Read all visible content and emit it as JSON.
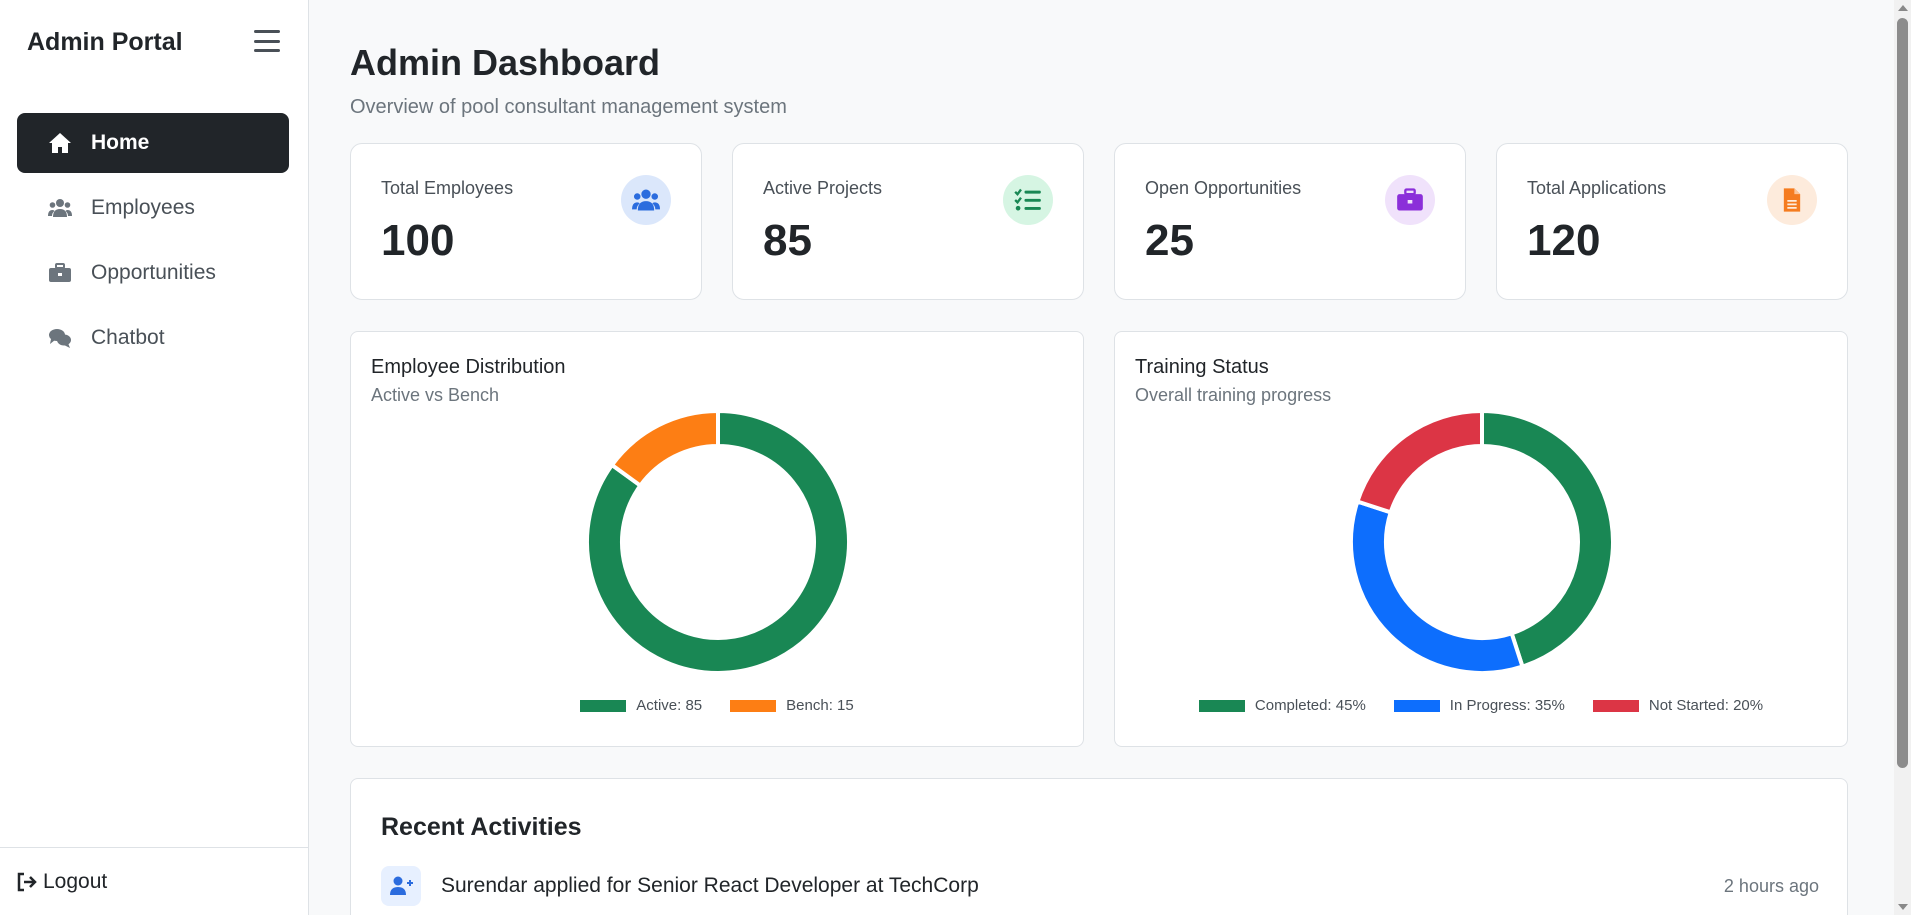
{
  "sidebar": {
    "brand": "Admin Portal",
    "items": [
      {
        "label": "Home",
        "icon": "home-icon",
        "active": true
      },
      {
        "label": "Employees",
        "icon": "users-icon",
        "active": false
      },
      {
        "label": "Opportunities",
        "icon": "briefcase-icon",
        "active": false
      },
      {
        "label": "Chatbot",
        "icon": "comments-icon",
        "active": false
      }
    ],
    "logout_label": "Logout"
  },
  "header": {
    "title": "Admin Dashboard",
    "subtitle": "Overview of pool consultant management system"
  },
  "stats": [
    {
      "label": "Total Employees",
      "value": "100",
      "icon": "users-icon",
      "color": "#2b6cde",
      "bg": "#dbe7fb"
    },
    {
      "label": "Active Projects",
      "value": "85",
      "icon": "tasks-icon",
      "color": "#198754",
      "bg": "#d6f5e3"
    },
    {
      "label": "Open Opportunities",
      "value": "25",
      "icon": "briefcase-icon",
      "color": "#8b2fd9",
      "bg": "#f0e2fb"
    },
    {
      "label": "Total Applications",
      "value": "120",
      "icon": "file-icon",
      "color": "#f57c20",
      "bg": "#fdebdc"
    }
  ],
  "charts": [
    {
      "title": "Employee Distribution",
      "subtitle": "Active vs Bench"
    },
    {
      "title": "Training Status",
      "subtitle": "Overall training progress"
    }
  ],
  "chart_data": [
    {
      "type": "pie",
      "title": "Employee Distribution",
      "subtitle": "Active vs Bench",
      "categories": [
        "Active",
        "Bench"
      ],
      "values": [
        85,
        15
      ],
      "legend_labels": [
        "Active: 85",
        "Bench: 15"
      ],
      "colors": [
        "#198754",
        "#fd7e14"
      ],
      "legend": "bottom"
    },
    {
      "type": "pie",
      "title": "Training Status",
      "subtitle": "Overall training progress",
      "categories": [
        "Completed",
        "In Progress",
        "Not Started"
      ],
      "values": [
        45,
        35,
        20
      ],
      "legend_labels": [
        "Completed: 45%",
        "In Progress: 35%",
        "Not Started: 20%"
      ],
      "colors": [
        "#198754",
        "#0d6efd",
        "#dc3545"
      ],
      "legend": "bottom"
    }
  ],
  "activities": {
    "title": "Recent Activities",
    "items": [
      {
        "text": "Surendar applied for Senior React Developer at TechCorp",
        "time": "2 hours ago",
        "icon": "user-plus-icon"
      }
    ]
  }
}
